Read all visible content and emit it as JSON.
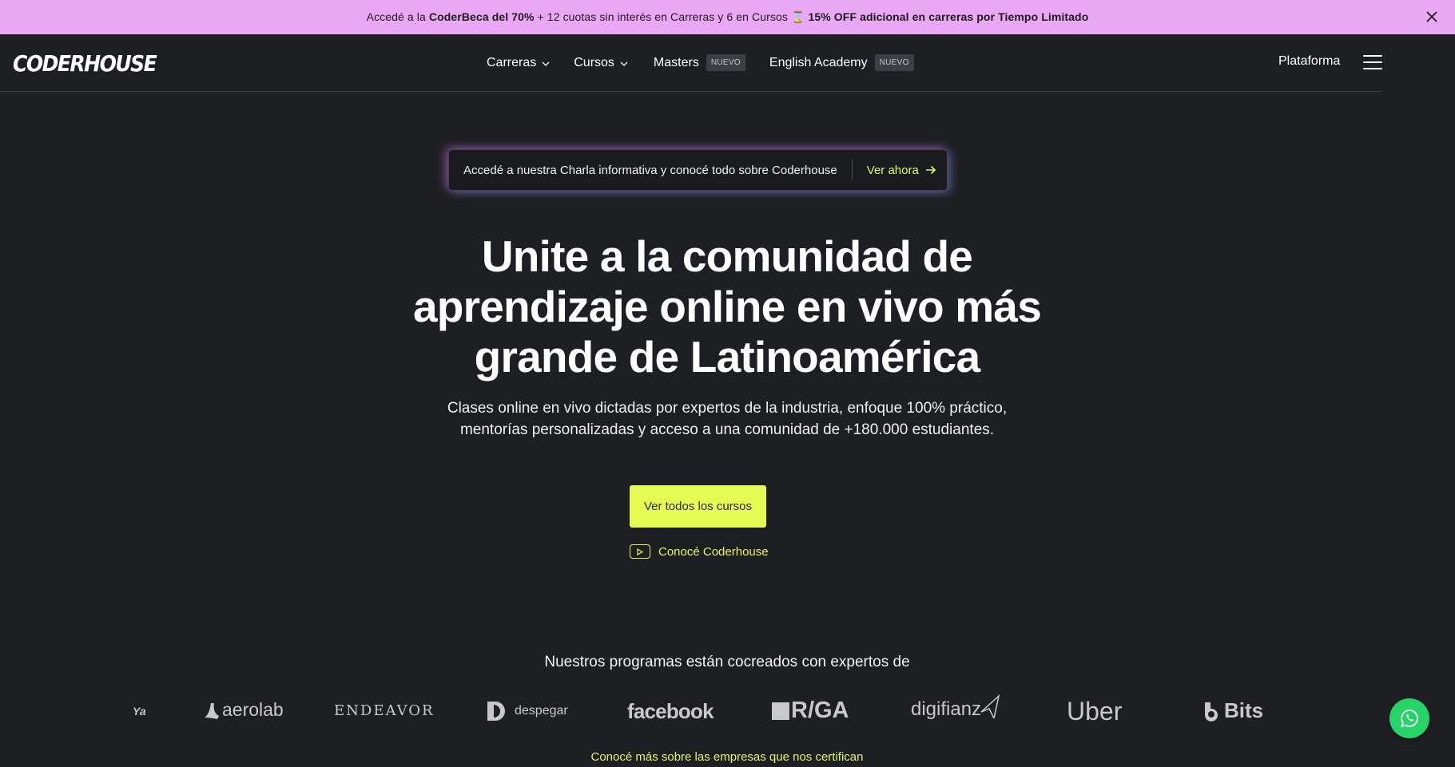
{
  "promo": {
    "part1": "Accedé a la ",
    "bold1": "CoderBeca del 70%",
    "part2": " + 12 cuotas sin interés en Carreras y 6 en Cursos ⌛ ",
    "bold2": "15% OFF adicional en carreras por Tiempo Limitado",
    "close_icon": "close-icon"
  },
  "nav": {
    "logo": "CODERHOUSE",
    "links": [
      {
        "label": "Carreras",
        "icon": "chevron-down-icon"
      },
      {
        "label": "Cursos",
        "icon": "chevron-down-icon"
      },
      {
        "label": "Masters",
        "badge": "NUEVO"
      },
      {
        "label": "English Academy",
        "badge": "NUEVO"
      }
    ],
    "plataforma": "Plataforma",
    "menu_icon": "hamburger-menu-icon"
  },
  "info_bar": {
    "text": "Accedé a nuestra Charla informativa y conocé todo sobre Coderhouse",
    "cta": "Ver ahora",
    "cta_icon": "arrow-right-icon"
  },
  "hero": {
    "title_line1": "Unite a la comunidad de",
    "title_line2": "aprendizaje online en vivo más",
    "title_line3": "grande de Latinoamérica",
    "subtitle_line1": "Clases online en vivo dictadas por expertos de la industria, enfoque 100% práctico,",
    "subtitle_line2": "mentorías personalizadas y acceso a una comunidad de +180.000 estudiantes.",
    "primary_button": "Ver todos los cursos",
    "video_link": "Conocé Coderhouse",
    "video_icon": "play-icon"
  },
  "partners": {
    "title": "Nuestros programas están cocreados con expertos de",
    "logos": [
      "Ya",
      "aerolab",
      "ENDEAVOR",
      "despegar",
      "facebook",
      "R/GA",
      "digifianz",
      "Uber",
      "Bits"
    ],
    "link": "Conocé más sobre las empresas que nos certifican"
  },
  "whatsapp_icon": "whatsapp-icon",
  "colors": {
    "promo_bg": "#eaa7f4",
    "page_bg": "#1e1f22",
    "accent": "#e3fb52",
    "whatsapp": "#26d366"
  }
}
